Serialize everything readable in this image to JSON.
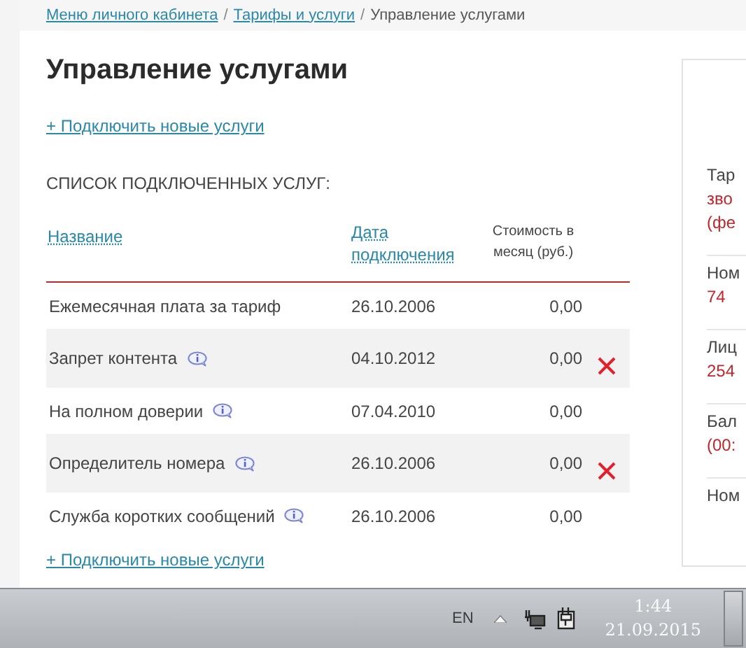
{
  "breadcrumbs": [
    {
      "label": "Меню личного кабинета",
      "kind": "link"
    },
    {
      "label": "/",
      "kind": "separator"
    },
    {
      "label": "Тарифы и услуги",
      "kind": "link"
    },
    {
      "label": "/",
      "kind": "separator"
    },
    {
      "label": "Управление услугами",
      "kind": "current"
    }
  ],
  "title": "Управление услугами",
  "add_link_top": "+ Подключить новые услуги",
  "list_heading": "СПИСОК ПОДКЛЮЧЕННЫХ УСЛУГ:",
  "table": {
    "columns": [
      "Название",
      "Дата подключения",
      "Стоимость в месяц (руб.)"
    ],
    "rows": [
      {
        "name": "Ежемесячная плата за тариф",
        "info": false,
        "date": "26.10.2006",
        "cost": "0,00",
        "removable": false
      },
      {
        "name": "Запрет контента",
        "info": true,
        "date": "04.10.2012",
        "cost": "0,00",
        "removable": true
      },
      {
        "name": "На полном доверии",
        "info": true,
        "date": "07.04.2010",
        "cost": "0,00",
        "removable": false
      },
      {
        "name": "Определитель номера",
        "info": true,
        "date": "26.10.2006",
        "cost": "0,00",
        "removable": true
      },
      {
        "name": "Служба коротких сообщений",
        "info": true,
        "date": "26.10.2006",
        "cost": "0,00",
        "removable": false
      }
    ]
  },
  "add_link_bottom": "+ Подключить новые услуги",
  "side_panel": [
    {
      "label": "Тар",
      "value_lines": [
        "зво",
        "(фе"
      ]
    },
    {
      "label": "Ном",
      "value_lines": [
        "74"
      ]
    },
    {
      "label": "Лиц",
      "value_lines": [
        "254"
      ]
    },
    {
      "label": "Бал",
      "value_lines": [
        "(00:"
      ]
    },
    {
      "label": "Ном"
    }
  ],
  "taskbar": {
    "language": "EN",
    "time": "1:44",
    "date": "21.09.2015"
  }
}
